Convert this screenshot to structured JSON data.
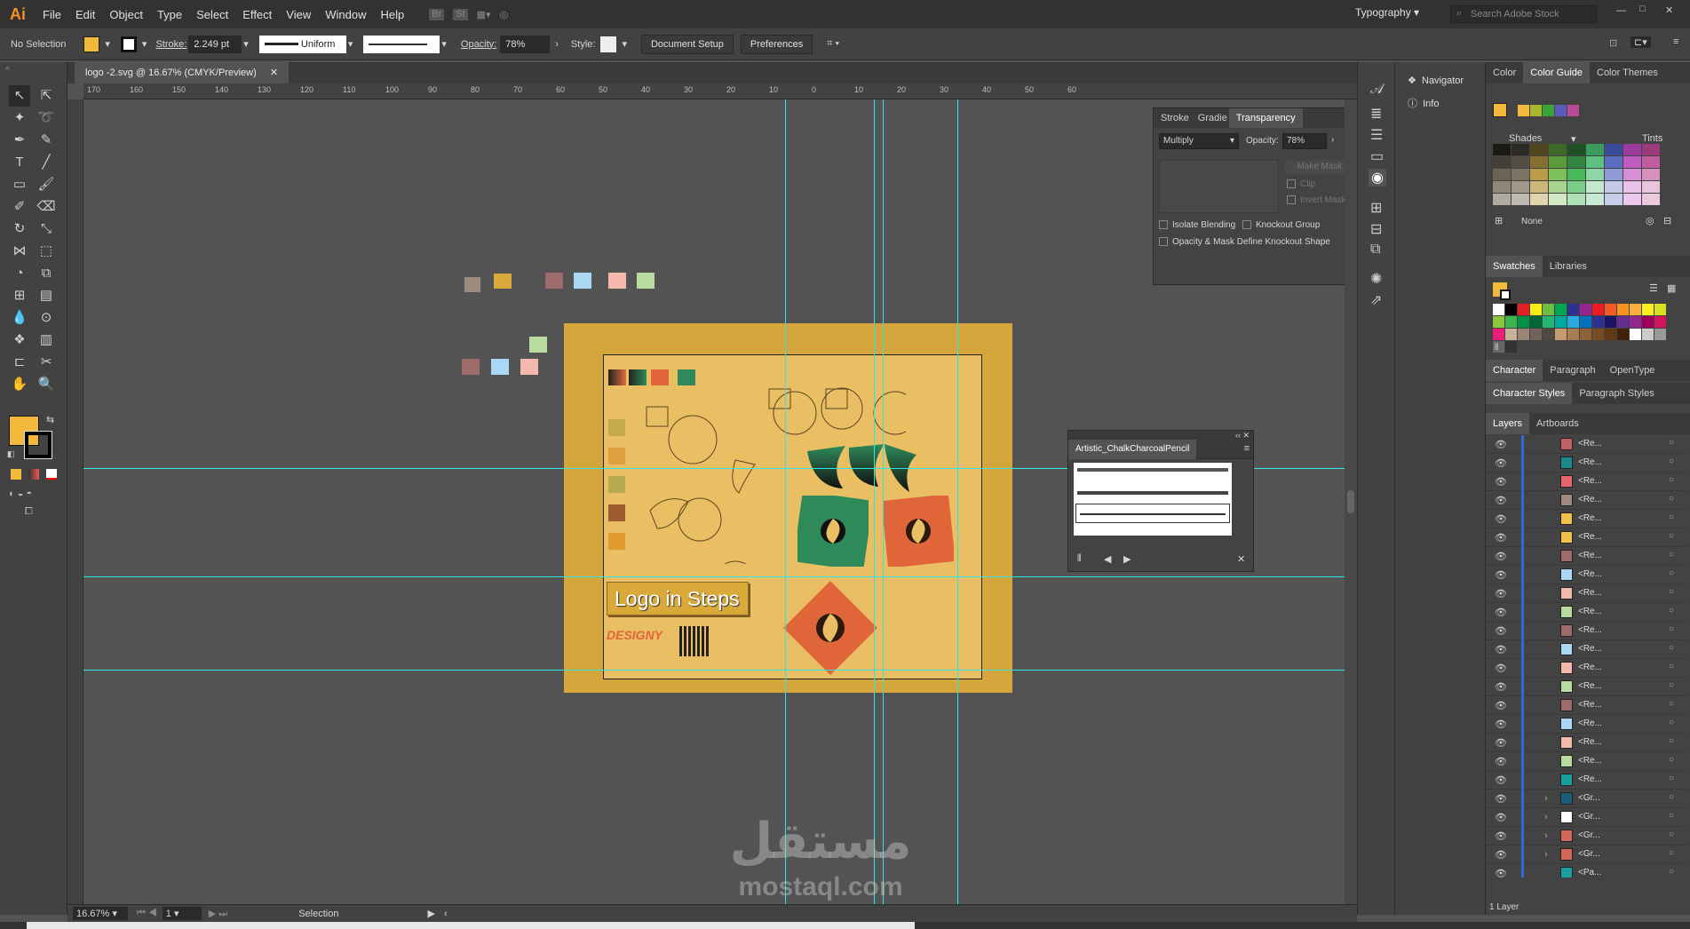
{
  "app": {
    "logo": "Ai"
  },
  "menu": [
    "File",
    "Edit",
    "Object",
    "Type",
    "Select",
    "Effect",
    "View",
    "Window",
    "Help"
  ],
  "workspace": "Typography",
  "search_placeholder": "Search Adobe Stock",
  "control": {
    "selection": "No Selection",
    "stroke_label": "Stroke:",
    "stroke_value": "2.249 pt",
    "profile": "Uniform",
    "opacity_label": "Opacity:",
    "opacity_value": "78%",
    "style_label": "Style:",
    "doc_setup": "Document Setup",
    "preferences": "Preferences"
  },
  "document_tab": "logo -2.svg @ 16.67% (CMYK/Preview)",
  "ruler_ticks": [
    "170",
    "160",
    "150",
    "140",
    "130",
    "120",
    "110",
    "100",
    "90",
    "80",
    "70",
    "60",
    "50",
    "40",
    "30",
    "20",
    "10",
    "0",
    "10",
    "20",
    "30",
    "40",
    "50",
    "60"
  ],
  "artboard": {
    "title": "Logo in Steps",
    "brand": "DESIGNY"
  },
  "transparency": {
    "tabs": [
      "Stroke",
      "Gradie",
      "Transparency"
    ],
    "blend_mode": "Multiply",
    "opacity_label": "Opacity:",
    "opacity_value": "78%",
    "make_mask": "Make Mask",
    "clip": "Clip",
    "invert_mask": "Invert Mask",
    "isolate": "Isolate Blending",
    "knockout": "Knockout Group",
    "opacity_mask": "Opacity & Mask Define Knockout Shape"
  },
  "brush_panel": {
    "title": "Artistic_ChalkCharcoalPencil"
  },
  "side_panels": {
    "navigator": "Navigator",
    "info": "Info"
  },
  "color_panel": {
    "tabs": [
      "Color",
      "Color Guide",
      "Color Themes"
    ],
    "shades": "Shades",
    "tints": "Tints",
    "none": "None"
  },
  "swatch_panel": {
    "tabs": [
      "Swatches",
      "Libraries"
    ]
  },
  "char_panel": {
    "tabs": [
      "Character",
      "Paragraph",
      "OpenType"
    ]
  },
  "styles_panel": {
    "tabs": [
      "Character Styles",
      "Paragraph Styles"
    ]
  },
  "layers_panel": {
    "tabs": [
      "Layers",
      "Artboards"
    ],
    "rows": [
      {
        "label": "<Re...",
        "color": "#c26067"
      },
      {
        "label": "<Re...",
        "color": "#1a8a8a"
      },
      {
        "label": "<Re...",
        "color": "#e8646c"
      },
      {
        "label": "<Re...",
        "color": "#9e8a7d"
      },
      {
        "label": "<Re...",
        "color": "#f2c14a"
      },
      {
        "label": "<Re...",
        "color": "#f2c14a"
      },
      {
        "label": "<Re...",
        "color": "#9e6b6b"
      },
      {
        "label": "<Re...",
        "color": "#a8d8f5"
      },
      {
        "label": "<Re...",
        "color": "#f5b8ae"
      },
      {
        "label": "<Re...",
        "color": "#b8dca0"
      },
      {
        "label": "<Re...",
        "color": "#9e6b6b"
      },
      {
        "label": "<Re...",
        "color": "#a8d8f5"
      },
      {
        "label": "<Re...",
        "color": "#f5b8ae"
      },
      {
        "label": "<Re...",
        "color": "#b8dca0"
      },
      {
        "label": "<Re...",
        "color": "#9e6b6b"
      },
      {
        "label": "<Re...",
        "color": "#a8d8f5"
      },
      {
        "label": "<Re...",
        "color": "#f5b8ae"
      },
      {
        "label": "<Re...",
        "color": "#b8dca0"
      },
      {
        "label": "<Re...",
        "color": "#1a9e9e"
      },
      {
        "label": "<Gr...",
        "color": "#1a5a7a"
      },
      {
        "label": "<Gr...",
        "color": "#ffffff"
      },
      {
        "label": "<Gr...",
        "color": "#d4665a"
      },
      {
        "label": "<Gr...",
        "color": "#d4665a"
      },
      {
        "label": "<Pa...",
        "color": "#1a9e9e"
      }
    ],
    "footer": "1 Layer"
  },
  "status": {
    "zoom": "16.67%",
    "page": "1",
    "tool": "Selection"
  },
  "watermark": {
    "arabic": "مستقل",
    "latin": "mostaql.com"
  }
}
